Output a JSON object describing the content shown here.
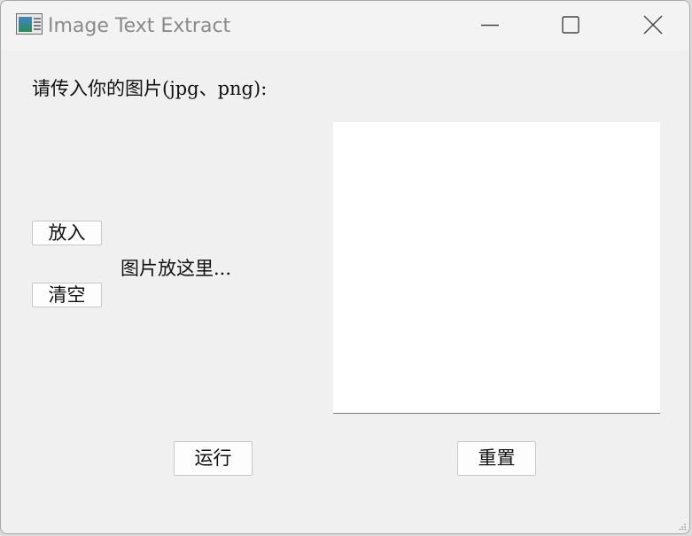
{
  "window": {
    "title": "Image Text Extract",
    "icon": "app-window-icon",
    "controls": {
      "minimize": "minimize-icon",
      "maximize": "maximize-icon",
      "close": "close-icon"
    }
  },
  "main": {
    "prompt": "请传入你的图片(jpg、png):",
    "put_label": "放入",
    "clear_label": "清空",
    "drop_hint": "图片放这里...",
    "output_text": "",
    "run_label": "运行",
    "reset_label": "重置"
  },
  "colors": {
    "window_bg": "#f0f0f0",
    "title_text": "#8a8a8a",
    "button_bg": "#fdfdfd",
    "button_border": "#c7c7c7",
    "output_bg": "#ffffff"
  }
}
